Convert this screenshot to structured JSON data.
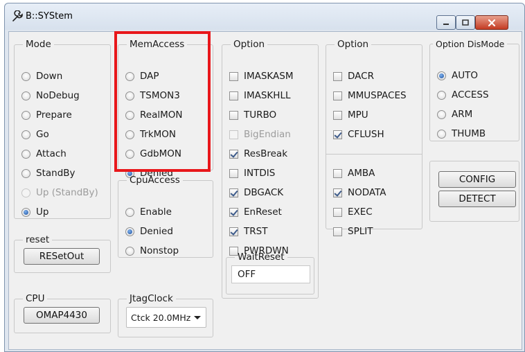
{
  "window": {
    "title": "B::SYStem",
    "app_icon": "wrench-icon",
    "controls": {
      "minimize": "minimize-icon",
      "maximize": "maximize-icon",
      "close": "close-icon"
    }
  },
  "mode": {
    "legend": "Mode",
    "options": [
      "Down",
      "NoDebug",
      "Prepare",
      "Go",
      "Attach",
      "StandBy",
      "Up (StandBy)",
      "Up"
    ],
    "selected": "Up",
    "disabled": [
      "Up (StandBy)"
    ]
  },
  "reset": {
    "legend": "reset",
    "button": "RESetOut"
  },
  "cpu": {
    "legend": "CPU",
    "button": "OMAP4430"
  },
  "memaccess": {
    "legend": "MemAccess",
    "options": [
      "DAP",
      "TSMON3",
      "RealMON",
      "TrkMON",
      "GdbMON",
      "Denied"
    ],
    "selected": "Denied",
    "highlight_color": "#e8171b"
  },
  "cpuaccess": {
    "legend": "CpuAccess",
    "options": [
      "Enable",
      "Denied",
      "Nonstop"
    ],
    "selected": "Denied"
  },
  "jtagclock": {
    "legend": "JtagClock",
    "value": "Ctck 20.0MHz"
  },
  "option1": {
    "legend": "Option",
    "items": [
      {
        "label": "IMASKASM",
        "checked": false,
        "disabled": false
      },
      {
        "label": "IMASKHLL",
        "checked": false,
        "disabled": false
      },
      {
        "label": "TURBO",
        "checked": false,
        "disabled": false
      },
      {
        "label": "BigEndian",
        "checked": false,
        "disabled": true
      },
      {
        "label": "ResBreak",
        "checked": true,
        "disabled": false
      },
      {
        "label": "INTDIS",
        "checked": false,
        "disabled": false
      },
      {
        "label": "DBGACK",
        "checked": true,
        "disabled": false
      },
      {
        "label": "EnReset",
        "checked": true,
        "disabled": false
      },
      {
        "label": "TRST",
        "checked": true,
        "disabled": false
      },
      {
        "label": "PWRDWN",
        "checked": false,
        "disabled": false
      }
    ]
  },
  "waitreset": {
    "legend": "WaitReset",
    "value": "OFF"
  },
  "option2": {
    "legend": "Option",
    "items_top": [
      {
        "label": "DACR",
        "checked": false
      },
      {
        "label": "MMUSPACES",
        "checked": false
      },
      {
        "label": "MPU",
        "checked": false
      },
      {
        "label": "CFLUSH",
        "checked": true
      }
    ],
    "items_bottom": [
      {
        "label": "AMBA",
        "checked": false
      },
      {
        "label": "NODATA",
        "checked": true
      },
      {
        "label": "EXEC",
        "checked": false
      },
      {
        "label": "SPLIT",
        "checked": false
      }
    ]
  },
  "dismode": {
    "legend": "Option DisMode",
    "options": [
      "AUTO",
      "ACCESS",
      "ARM",
      "THUMB"
    ],
    "selected": "AUTO"
  },
  "actions": {
    "config": "CONFIG",
    "detect": "DETECT"
  }
}
